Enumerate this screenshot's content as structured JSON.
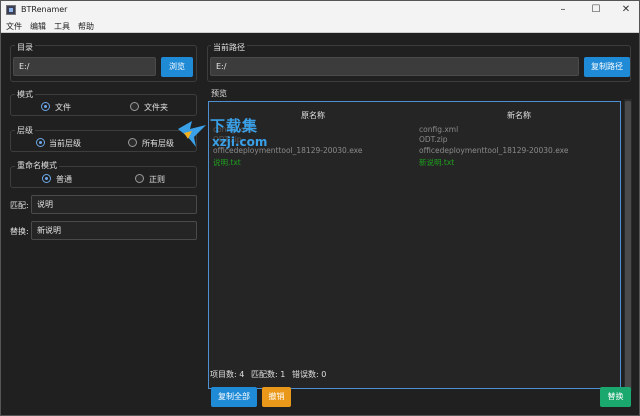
{
  "window": {
    "title": "BTRenamer"
  },
  "menu": [
    "文件",
    "编辑",
    "工具",
    "帮助"
  ],
  "directory": {
    "label": "目录",
    "value": "E:/",
    "browse_label": "浏览"
  },
  "mode": {
    "label": "模式",
    "options": [
      "文件",
      "文件夹"
    ],
    "selected": 0
  },
  "level": {
    "label": "层级",
    "options": [
      "当前层级",
      "所有层级"
    ],
    "selected": 0
  },
  "rename_mode": {
    "label": "重命名模式",
    "options": [
      "普通",
      "正则"
    ],
    "selected": 0
  },
  "match": {
    "label": "匹配:",
    "value": "说明"
  },
  "replace": {
    "label": "替换:",
    "value": "新说明"
  },
  "current_path": {
    "label": "当前路径",
    "value": "E:/",
    "copy_label": "复制路径"
  },
  "preview": {
    "label": "预览",
    "columns": [
      "原名称",
      "新名称"
    ],
    "rows": [
      {
        "original": "config.xml",
        "new": "config.xml",
        "highlight": false,
        "original_obscured": true
      },
      {
        "original": "ODT.zip",
        "new": "ODT.zip",
        "highlight": false
      },
      {
        "original": "officedeploymenttool_18129-20030.exe",
        "new": "officedeploymenttool_18129-20030.exe",
        "highlight": false
      },
      {
        "original": "说明.txt",
        "new": "新说明.txt",
        "highlight": true
      }
    ],
    "highlight_color": "#1fa01f"
  },
  "stats": {
    "items": "项目数: 4",
    "matches": "匹配数: 1",
    "errors": "错误数: 0"
  },
  "buttons": {
    "copy_all": "复制全部",
    "undo": "撤销",
    "replace": "替换"
  },
  "watermark": {
    "text_cn": "下载集",
    "text_en": "xzji.com"
  },
  "colors": {
    "accent_blue": "#1f8ad6",
    "accent_orange": "#e99819",
    "accent_green": "#1aa86e"
  }
}
